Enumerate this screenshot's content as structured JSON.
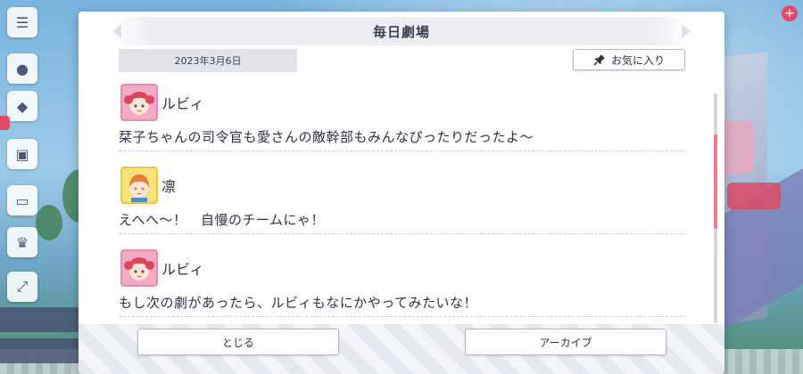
{
  "dialog": {
    "title": "毎日劇場",
    "date": "2023年3月6日",
    "favorite_label": "お気に入り",
    "icons": {
      "favorite": "pin-icon"
    }
  },
  "entries": [
    {
      "speaker": "ルビィ",
      "avatar": "ruby-avatar",
      "line": "栞子ちゃんの司令官も愛さんの敵幹部もみんなぴったりだったよ〜"
    },
    {
      "speaker": "凛",
      "avatar": "rin-avatar",
      "line": "えへへ〜！　自慢のチームにゃ！"
    },
    {
      "speaker": "ルビィ",
      "avatar": "ruby-avatar",
      "line": "もし次の劇があったら、ルビィもなにかやってみたいな！"
    }
  ],
  "scroll": {
    "position": 0.18
  },
  "buttons": {
    "close_label": "とじる",
    "archive_label": "アーカイブ"
  },
  "colors": {
    "accent": "#f07a90",
    "text": "#2e3244",
    "panel": "#ffffff"
  }
}
